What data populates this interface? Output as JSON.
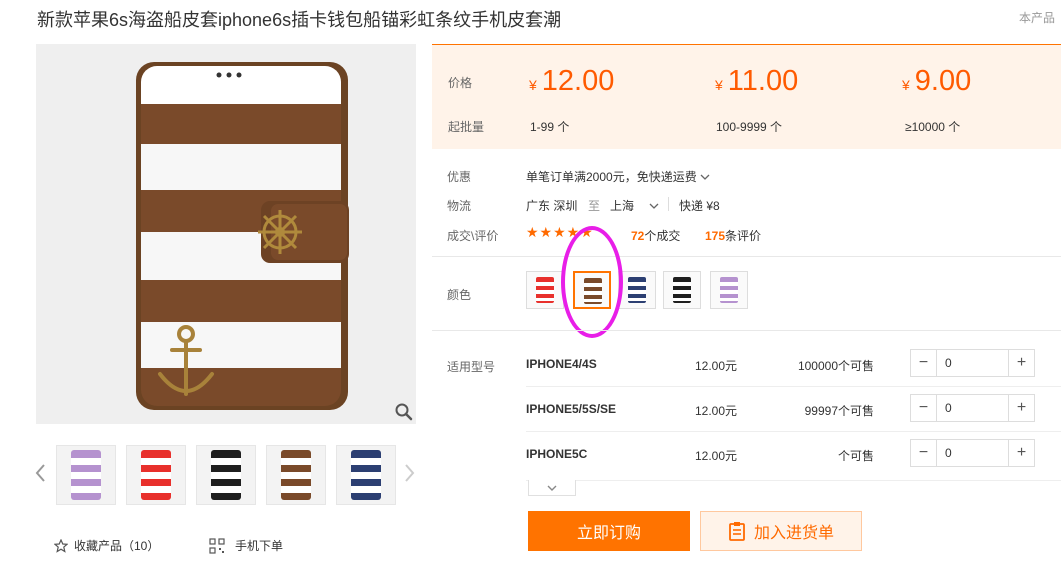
{
  "product": {
    "title": "新款苹果6s海盗船皮套iphone6s插卡钱包船锚彩虹条纹手机皮套潮",
    "side_note": "本产品"
  },
  "price_box": {
    "price_label": "价格",
    "moq_label": "起批量",
    "currency": "¥",
    "tiers": [
      {
        "price": "12.00",
        "qty": "1-99 个"
      },
      {
        "price": "11.00",
        "qty": "100-9999 个"
      },
      {
        "price": "9.00",
        "qty": "≥10000 个"
      }
    ]
  },
  "info": {
    "promo_label": "优惠",
    "promo_text": "单笔订单满2000元，免快递运费",
    "logistics_label": "物流",
    "origin": "广东 深圳",
    "to": "至",
    "destination": "上海",
    "shipping": "快递 ¥8",
    "deal_label": "成交\\评价",
    "stars": "★★★★★",
    "deals_count": "72",
    "deals_suffix": "个成交",
    "reviews_count": "175",
    "reviews_suffix": "条评价"
  },
  "colors": {
    "label": "颜色",
    "options": [
      {
        "name": "red",
        "stripe": "#e8302c"
      },
      {
        "name": "brown",
        "stripe": "#7a4a2a"
      },
      {
        "name": "navy",
        "stripe": "#2c3f72"
      },
      {
        "name": "black",
        "stripe": "#1f1f1f"
      },
      {
        "name": "purple",
        "stripe": "#b592cf"
      }
    ],
    "selected_index": 1
  },
  "models": {
    "label": "适用型号",
    "rows": [
      {
        "name": "IPHONE4/4S",
        "price": "12.00元",
        "stock": "100000个可售",
        "qty": "0"
      },
      {
        "name": "IPHONE5/5S/SE",
        "price": "12.00元",
        "stock": "99997个可售",
        "qty": "0"
      },
      {
        "name": "IPHONE5C",
        "price": "12.00元",
        "stock": "个可售",
        "qty": "0"
      }
    ],
    "minus": "−",
    "plus": "+"
  },
  "actions": {
    "order": "立即订购",
    "add_to_cart": "加入进货单",
    "favorite": "收藏产品（10）",
    "mobile_order": "手机下单"
  },
  "gallery": {
    "thumbnails": [
      "purple",
      "red",
      "black",
      "brown",
      "navy"
    ]
  },
  "theme": {
    "accent": "#ff7300",
    "price_bg": "#fff3e9",
    "highlight": "#e81ee8"
  }
}
